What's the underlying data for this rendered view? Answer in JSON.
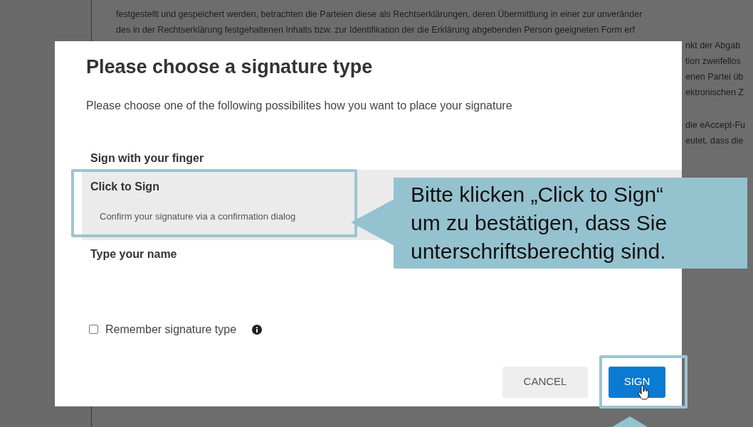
{
  "document": {
    "lines": [
      {
        "text": "festgestellt und gespeichert werden, betrachten die Parteien diese als Rechtserklärungen, deren Übermittlung in einer zur unveränder",
        "kind": "full"
      },
      {
        "text": "des in der Rechtserklärung festgehaltenen Inhalts bzw. zur Identifikation der die Erklärung abgebenden Person geeigneten Form erf",
        "kind": "full"
      },
      {
        "text": "nkt der Abgab",
        "kind": "side"
      },
      {
        "text": "tion zweifellos",
        "kind": "side"
      },
      {
        "text": "enen Partei üb",
        "kind": "side"
      },
      {
        "text": "ektronischen Z",
        "kind": "side"
      },
      {
        "text": "die eAccept-Fu",
        "kind": "side-gap"
      },
      {
        "text": "eutet, dass die",
        "kind": "side"
      }
    ]
  },
  "dialog": {
    "title": "Please choose a signature type",
    "subtitle": "Please choose one of the following possibilites how you want to place your signature",
    "options": [
      {
        "label": "Sign with your finger",
        "selected": false
      },
      {
        "label": "Click to Sign",
        "description": "Confirm your signature via a confirmation dialog",
        "selected": true
      },
      {
        "label": "Type your name",
        "selected": false
      }
    ],
    "remember": {
      "label": "Remember signature type",
      "checked": false
    },
    "buttons": [
      {
        "label": "CANCEL",
        "kind": "secondary"
      },
      {
        "label": "SIGN",
        "kind": "primary"
      }
    ]
  },
  "callout": {
    "lines": [
      "Bitte klicken „Click to Sign“",
      "um zu bestätigen, dass Sie",
      "unterschriftsberechtig sind."
    ]
  }
}
